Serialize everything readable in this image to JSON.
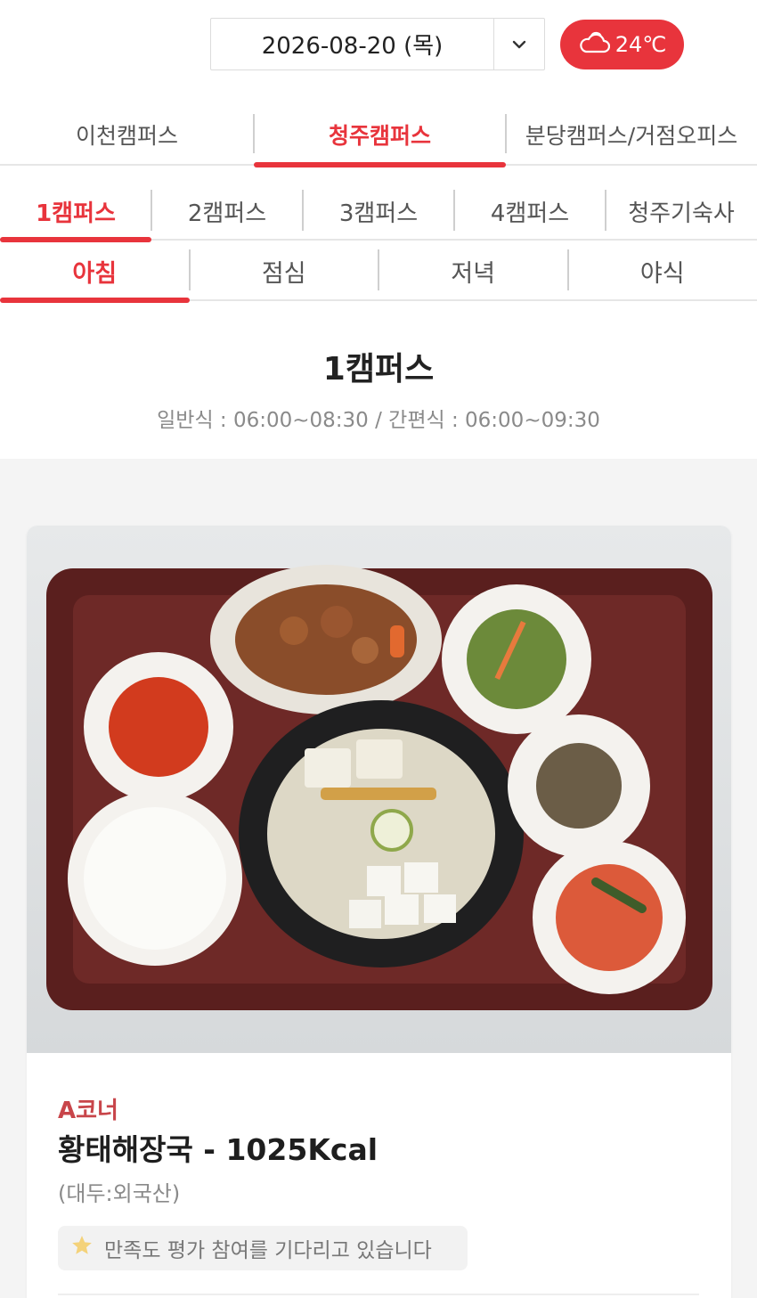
{
  "header": {
    "date": "2026-08-20 (목)",
    "weather_temp": "24℃",
    "weather_icon": "cloud-sun-icon"
  },
  "campus_tabs": [
    {
      "label": "이천캠퍼스",
      "active": false
    },
    {
      "label": "청주캠퍼스",
      "active": true
    },
    {
      "label": "분당캠퍼스/거점오피스",
      "active": false
    }
  ],
  "sub_tabs": [
    {
      "label": "1캠퍼스",
      "active": true
    },
    {
      "label": "2캠퍼스",
      "active": false
    },
    {
      "label": "3캠퍼스",
      "active": false
    },
    {
      "label": "4캠퍼스",
      "active": false
    },
    {
      "label": "청주기숙사",
      "active": false
    }
  ],
  "meal_tabs": [
    {
      "label": "아침",
      "active": true
    },
    {
      "label": "점심",
      "active": false
    },
    {
      "label": "저녁",
      "active": false
    },
    {
      "label": "야식",
      "active": false
    }
  ],
  "section": {
    "title": "1캠퍼스",
    "hours": "일반식 : 06:00~08:30 / 간편식 : 06:00~09:30"
  },
  "menu_card": {
    "corner": "A코너",
    "name": "황태해장국 - 1025Kcal",
    "origin": "(대두:외국산)",
    "rating_text": "만족도 평가 참여를 기다리고 있습니다",
    "rating_icon": "star-icon"
  },
  "colors": {
    "accent": "#e8343c",
    "corner_text": "#c8454a"
  }
}
